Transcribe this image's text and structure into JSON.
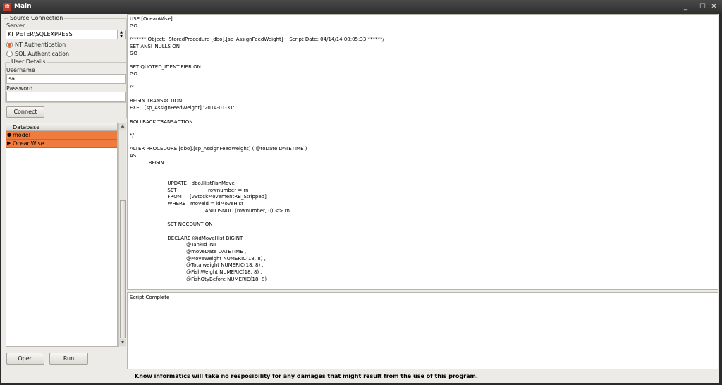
{
  "window": {
    "title": "Main",
    "minimize": "_",
    "maximize": "☐",
    "close": "✕"
  },
  "source_connection": {
    "legend": "Source Connection",
    "server_label": "Server",
    "server_value": "KI_PETER\\SQLEXPRESS",
    "auth_options": [
      "NT Authentication",
      "SQL Authentication"
    ],
    "selected_auth": "NT Authentication"
  },
  "user_details": {
    "legend": "User Details",
    "username_label": "Username",
    "username_value": "sa",
    "password_label": "Password",
    "password_value": ""
  },
  "connect_label": "Connect",
  "database": {
    "header": "Database",
    "items": [
      {
        "name": "model",
        "marker": "●"
      },
      {
        "name": "OceanWise",
        "marker": "▶"
      }
    ]
  },
  "buttons": {
    "open": "Open",
    "run": "Run"
  },
  "script_text": "USE [OceanWise]\nGO\n\n/****** Object:  StoredProcedure [dbo].[sp_AssignFeedWeight]    Script Date: 04/14/14 00:05:33 ******/\nSET ANSI_NULLS ON\nGO\n\nSET QUOTED_IDENTIFIER ON\nGO\n\n/*\n\nBEGIN TRANSACTION\nEXEC [sp_AssignFeedWeight] '2014-01-31'\n\nROLLBACK TRANSACTION\n\n*/\n\nALTER PROCEDURE [dbo].[sp_AssignFeedWeight] ( @toDate DATETIME )\nAS\n            BEGIN\n\n\n                        UPDATE   dbo.HistFishMove\n                        SET                    rownumber = rn\n                        FROM     [vStockMovementRB_Stripped]\n                        WHERE   moveid = idMoveHist\n                                                AND ISNULL(rownumber, 0) <> rn\n\n                        SET NOCOUNT ON\n\n                        DECLARE @idMoveHist BIGINT ,\n                                    @TankId INT ,\n                                    @moveDate DATETIME ,\n                                    @MoveWeight NUMERIC(18, 8) ,\n                                    @Totalweight NUMERIC(18, 8) ,\n                                    @FishWeight NUMERIC(18, 8) ,\n                                    @FishQtyBefore NUMERIC(18, 8) ,",
  "output_text": "Script Complete",
  "status_text": "Know informatics will take no resposibility for any damages that might result from the use of this program."
}
